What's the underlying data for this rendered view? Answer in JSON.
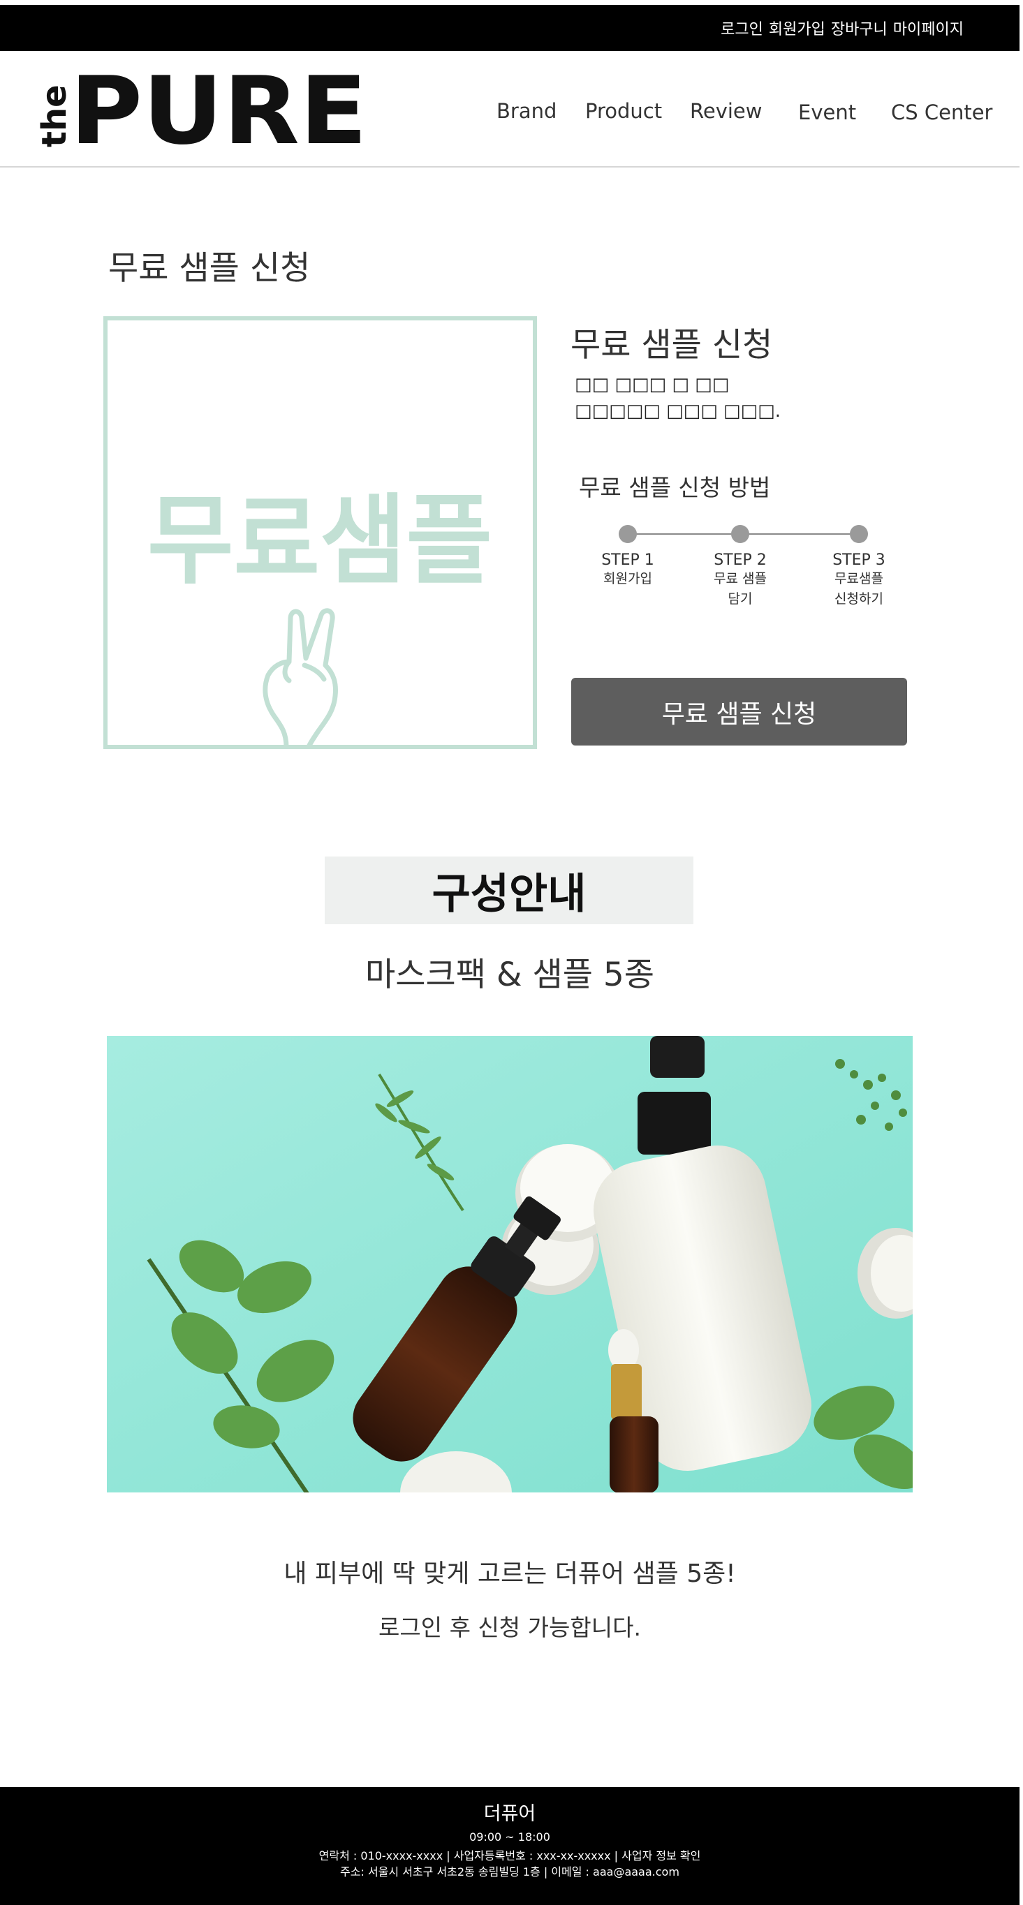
{
  "top_links": [
    "로그인",
    "회원가입",
    "장바구니",
    "마이페이지"
  ],
  "logo": {
    "small": "the",
    "main": "PURE"
  },
  "nav": [
    "Brand",
    "Product",
    "Review",
    "Event",
    "CS Center"
  ],
  "page_title": "무료 샘플 신청",
  "sample_image": {
    "text": "무료샘플",
    "icon": "peace-hand-icon",
    "color": "#c2e0d4"
  },
  "info": {
    "title": "무료 샘플 신청",
    "desc_line1": "□□ □□□ □ □□",
    "desc_line2": "□□□□□ □□□ □□□."
  },
  "method": {
    "title": "무료 샘플 신청 방법",
    "steps": [
      {
        "num": "STEP 1",
        "label": "회원가입",
        "label2": ""
      },
      {
        "num": "STEP 2",
        "label": "무료 샘플",
        "label2": "담기"
      },
      {
        "num": "STEP 3",
        "label": "무료샘플",
        "label2": "신청하기"
      }
    ]
  },
  "apply_button": "무료 샘플 신청",
  "composition": {
    "badge": "구성안내",
    "subtitle": "마스크팩 & 샘플 5종",
    "tagline": "내 피부에 딱 맞게 고르는 더퓨어 샘플 5종!",
    "login_note": "로그인 후 신청 가능합니다."
  },
  "footer": {
    "name": "더퓨어",
    "hours": "09:00 ~ 18:00",
    "contact": "연락처 : 010-xxxx-xxxx | 사업자등록번호 : xxx-xx-xxxxx | 사업자 정보 확인",
    "address": "주소: 서울시 서초구 서초2동 송림빌딩 1층 | 이메일 : aaa@aaaa.com"
  },
  "colors": {
    "accent_mint": "#c2e0d4",
    "button": "#5e5e5e",
    "photo_bg": "#7fe0cf"
  }
}
